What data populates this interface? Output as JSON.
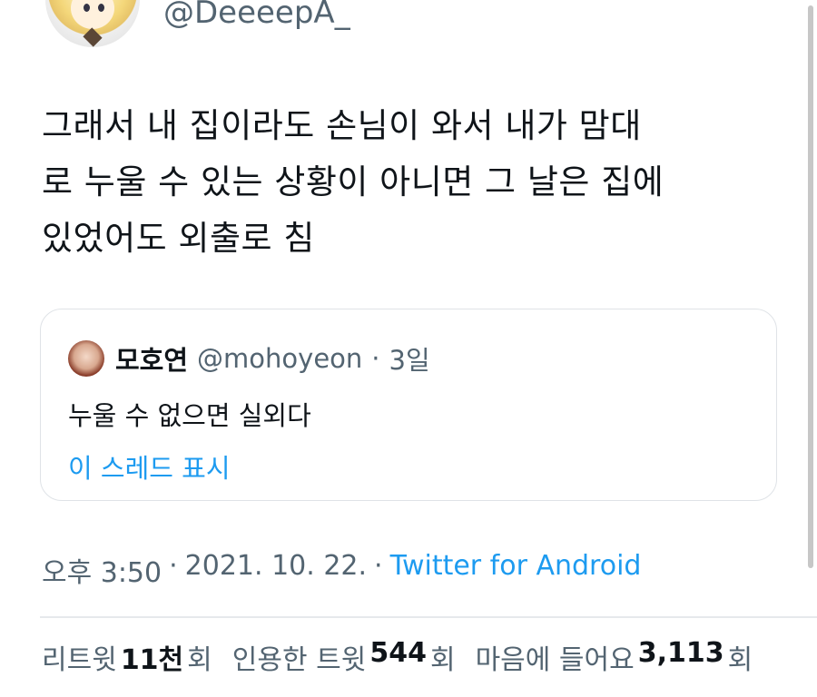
{
  "author": {
    "handle": "@DeeeepA_"
  },
  "tweet": {
    "lines": [
      "그래서 내 집이라도 손님이 와서 내가 맘대",
      "로 누울 수 있는 상황이 아니면 그 날은 집에",
      "있었어도 외출로 침"
    ]
  },
  "quote": {
    "name": "모호연",
    "handle": "@mohoyeon",
    "separator": "·",
    "time": "3일",
    "text": "누울 수 없으면 실외다",
    "show_thread": "이 스레드 표시"
  },
  "meta": {
    "time": "오후 3:50",
    "sep1": "·",
    "date": "2021. 10. 22.",
    "sep2": "·",
    "source": "Twitter for Android"
  },
  "stats": {
    "retweets": {
      "label": "리트윗",
      "count": "11천",
      "suffix": "회"
    },
    "quotes": {
      "label": "인용한 트윗",
      "count": "544",
      "suffix": "회"
    },
    "likes": {
      "label": "마음에 들어요",
      "count": "3,113",
      "suffix": "회"
    }
  },
  "colors": {
    "link": "#1d9bf0",
    "muted": "#536471",
    "text": "#0f1419"
  }
}
